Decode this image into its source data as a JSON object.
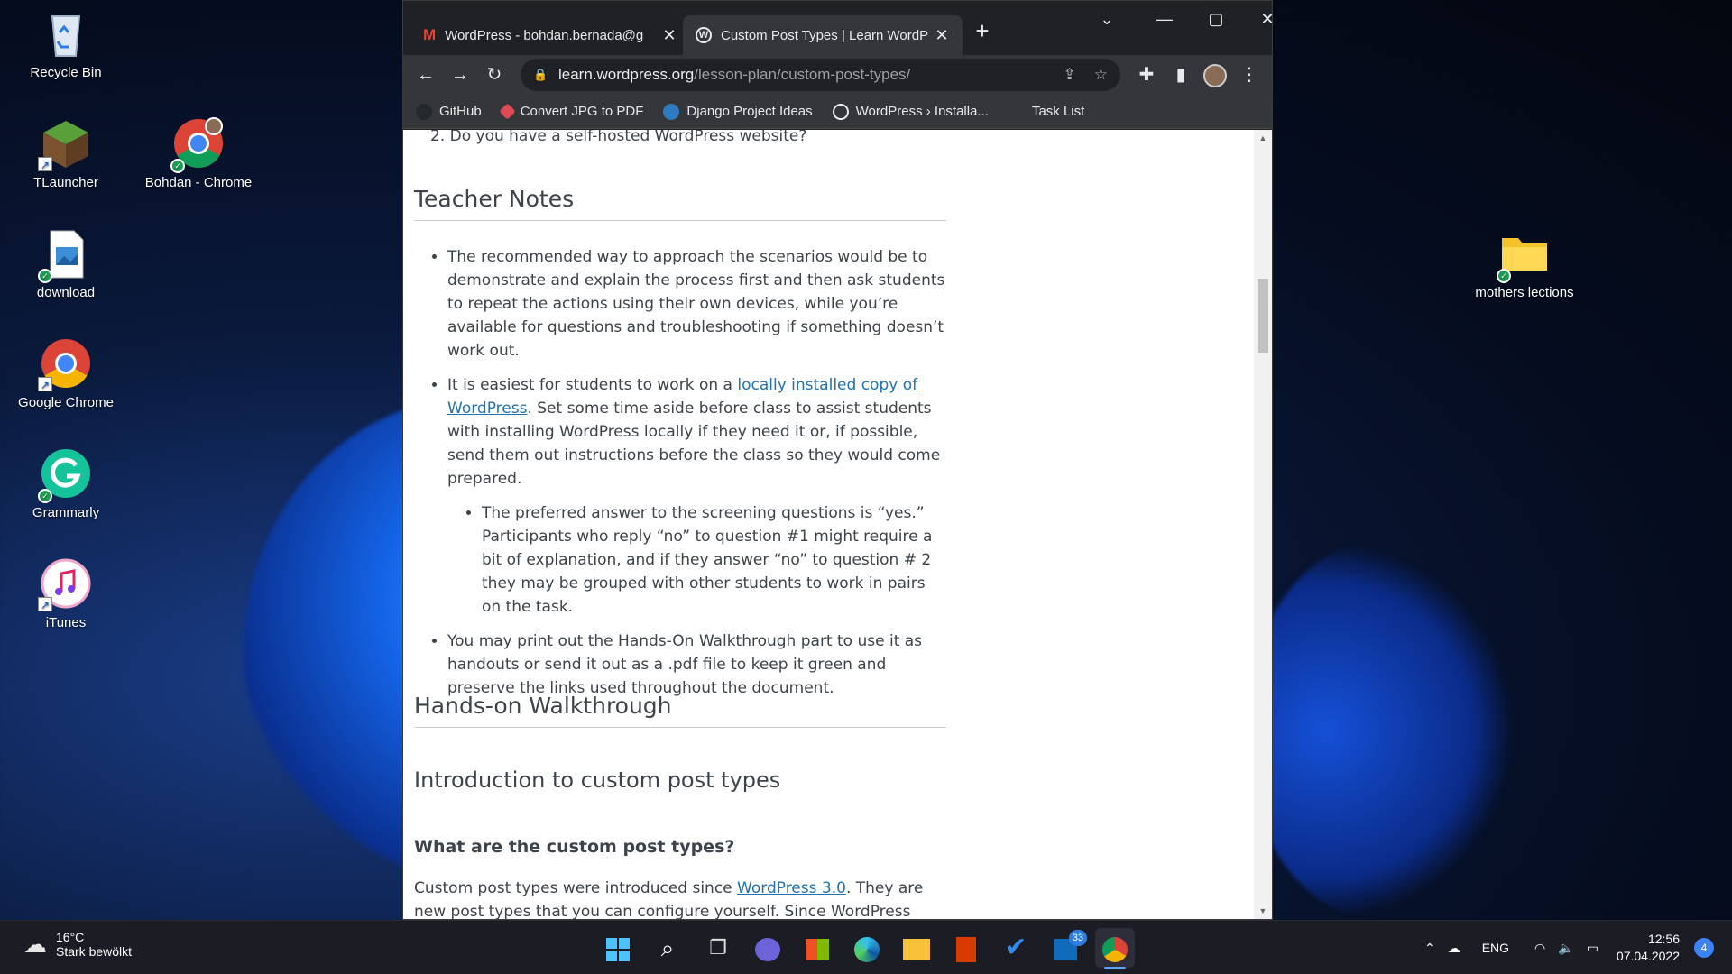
{
  "desktop": {
    "icons_left": [
      {
        "label": "Recycle Bin",
        "icon": "recycle-bin-icon"
      },
      {
        "label": "TLauncher",
        "icon": "minecraft-grass-block-icon"
      },
      {
        "label": "download",
        "icon": "image-file-icon"
      },
      {
        "label": "Google Chrome",
        "icon": "chrome-icon"
      },
      {
        "label": "Grammarly",
        "icon": "grammarly-icon"
      },
      {
        "label": "iTunes",
        "icon": "itunes-icon"
      }
    ],
    "icon_bohdan": {
      "label": "Bohdan - Chrome",
      "icon": "chrome-profile-icon"
    },
    "icon_right": {
      "label": "mothers lections",
      "icon": "folder-icon"
    }
  },
  "browser": {
    "tabs": [
      {
        "title": "WordPress - bohdan.bernada@g",
        "icon": "gmail-icon",
        "active": false
      },
      {
        "title": "Custom Post Types | Learn WordP",
        "icon": "wordpress-icon",
        "active": true
      }
    ],
    "new_tab": "+",
    "url_host": "learn.wordpress.org",
    "url_path": "/lesson-plan/custom-post-types/",
    "bookmarks": [
      {
        "label": "GitHub",
        "icon": "github-icon"
      },
      {
        "label": "Convert JPG to PDF",
        "icon": "convert-icon"
      },
      {
        "label": "Django Project Ideas",
        "icon": "django-icon"
      },
      {
        "label": "WordPress › Installa...",
        "icon": "wordpress-icon"
      },
      {
        "label": "Task List",
        "icon": "task-icon"
      }
    ]
  },
  "article": {
    "list_item_2": "2. Do you have a self-hosted WordPress website?",
    "teacher_notes_heading": "Teacher Notes",
    "note1": "The recommended way to approach the scenarios would be to demonstrate and explain the process first and then ask students to repeat the actions using their own devices, while you’re available for questions and troubleshooting if something doesn’t work out.",
    "note2_pre": "It is easiest for students to work on a ",
    "note2_link": "locally installed copy of WordPress",
    "note2_post": ". Set some time aside before class to assist students with installing WordPress locally if they need it or, if possible, send them out instructions before the class so they would come prepared.",
    "note2_sub": "The preferred answer to the screening questions is “yes.” Participants who reply “no” to question #1 might require a bit of explanation, and if they answer “no” to question # 2 they may be grouped with other students to work in pairs on the task.",
    "note3": "You may print out the Hands-On Walkthrough part to use it as handouts or send it out as a .pdf file to keep it green and preserve the links used throughout the document.",
    "walkthrough_heading": "Hands-on Walkthrough",
    "intro_heading": "Introduction to custom post types",
    "what_heading": "What are the custom post types?",
    "para_pre": "Custom post types were introduced since ",
    "para_link": "WordPress 3.0",
    "para_post": ". They are new post types that you can configure yourself. Since WordPress evolved"
  },
  "taskbar": {
    "weather_temp": "16°C",
    "weather_desc": "Stark bewölkt",
    "apps": [
      "windows-start-icon",
      "search-icon",
      "task-view-icon",
      "teams-chat-icon",
      "microsoft-store-icon",
      "edge-icon",
      "file-explorer-icon",
      "office-icon",
      "todo-icon",
      "outlook-icon",
      "chrome-icon"
    ],
    "outlook_badge": "33",
    "language": "ENG",
    "time": "12:56",
    "date": "07.04.2022",
    "notifications": "4"
  }
}
